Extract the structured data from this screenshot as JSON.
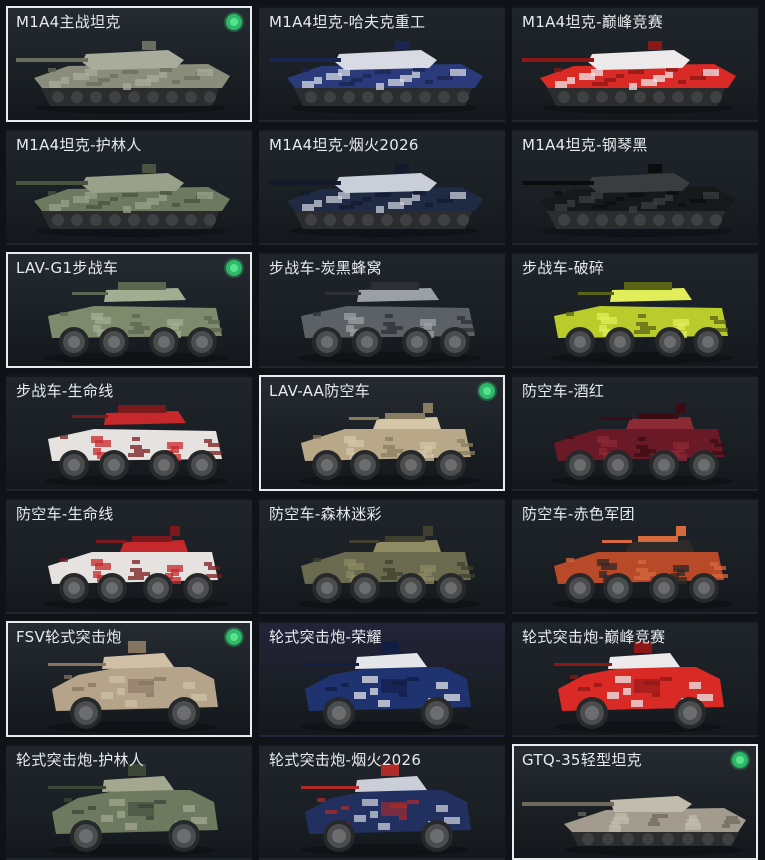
{
  "vehicles": [
    {
      "label": "M1A4主战坦克",
      "selected": true,
      "owned": true,
      "type": "tank",
      "colors": [
        "#8a8d7c",
        "#a9ab9b",
        "#6a6e5e"
      ],
      "bg": "#252b31"
    },
    {
      "label": "M1A4坦克-哈夫克重工",
      "selected": false,
      "owned": false,
      "type": "tank",
      "colors": [
        "#2a3a7a",
        "#d8dbe3",
        "#1c2550"
      ],
      "bg": "#1f252b"
    },
    {
      "label": "M1A4坦克-巅峰竞赛",
      "selected": false,
      "owned": false,
      "type": "tank",
      "colors": [
        "#d92a26",
        "#eceaea",
        "#8c1816"
      ],
      "bg": "#1f252b"
    },
    {
      "label": "M1A4坦克-护林人",
      "selected": false,
      "owned": false,
      "type": "tank",
      "colors": [
        "#6d7a5f",
        "#9aa18a",
        "#4a5441"
      ],
      "bg": "#1f252b"
    },
    {
      "label": "M1A4坦克-烟火2026",
      "selected": false,
      "owned": false,
      "type": "tank",
      "colors": [
        "#1f2a44",
        "#c9ced8",
        "#121a2c"
      ],
      "bg": "#1f252b"
    },
    {
      "label": "M1A4坦克-钢琴黑",
      "selected": false,
      "owned": false,
      "type": "tank",
      "colors": [
        "#16181a",
        "#3a3d40",
        "#0b0c0d"
      ],
      "bg": "#1f252b"
    },
    {
      "label": "LAV-G1步战车",
      "selected": true,
      "owned": true,
      "type": "ifv",
      "colors": [
        "#7e8a6c",
        "#a3ad92",
        "#5d6650"
      ],
      "bg": "#252b31"
    },
    {
      "label": "步战车-炭黑蜂窝",
      "selected": false,
      "owned": false,
      "type": "ifv",
      "colors": [
        "#5c6166",
        "#9aa0a4",
        "#2c2f33"
      ],
      "bg": "#1f252b"
    },
    {
      "label": "步战车-破碎",
      "selected": false,
      "owned": false,
      "type": "ifv",
      "colors": [
        "#b9cc2c",
        "#e1ee5a",
        "#5a6416"
      ],
      "bg": "#1f252b"
    },
    {
      "label": "步战车-生命线",
      "selected": false,
      "owned": false,
      "type": "ifv",
      "colors": [
        "#e6e2e0",
        "#c7282c",
        "#7a1a1c"
      ],
      "bg": "#1f252b"
    },
    {
      "label": "LAV-AA防空车",
      "selected": true,
      "owned": true,
      "type": "aa",
      "colors": [
        "#b8a888",
        "#d4c6a7",
        "#8a7c60"
      ],
      "bg": "#252b31"
    },
    {
      "label": "防空车-酒红",
      "selected": false,
      "owned": false,
      "type": "aa",
      "colors": [
        "#6a1a26",
        "#8c2a36",
        "#3c0c14"
      ],
      "bg": "#1f252b"
    },
    {
      "label": "防空车-生命线",
      "selected": false,
      "owned": false,
      "type": "aa",
      "colors": [
        "#e6e2e0",
        "#c7282c",
        "#7a1a1c"
      ],
      "bg": "#1f252b"
    },
    {
      "label": "防空车-森林迷彩",
      "selected": false,
      "owned": false,
      "type": "aa",
      "colors": [
        "#6a6b4e",
        "#8e8a62",
        "#3f4030"
      ],
      "bg": "#1f252b"
    },
    {
      "label": "防空车-赤色军团",
      "selected": false,
      "owned": false,
      "type": "aa",
      "colors": [
        "#b84a2a",
        "#2e2a28",
        "#d66a3c"
      ],
      "bg": "#1f252b"
    },
    {
      "label": "FSV轮式突击炮",
      "selected": true,
      "owned": true,
      "type": "fsv",
      "colors": [
        "#b6a48a",
        "#cfc0a6",
        "#857560"
      ],
      "bg": "#252b31"
    },
    {
      "label": "轮式突击炮-荣耀",
      "selected": false,
      "owned": false,
      "type": "fsv",
      "colors": [
        "#1e3370",
        "#e4e6ea",
        "#111d44"
      ],
      "bg": "#23233a"
    },
    {
      "label": "轮式突击炮-巅峰竞赛",
      "selected": false,
      "owned": false,
      "type": "fsv",
      "colors": [
        "#d92a26",
        "#eceaea",
        "#8c1816"
      ],
      "bg": "#1f252b"
    },
    {
      "label": "轮式突击炮-护林人",
      "selected": false,
      "owned": false,
      "type": "fsv",
      "colors": [
        "#6d7a5f",
        "#a3a88f",
        "#3e4638"
      ],
      "bg": "#1f252b"
    },
    {
      "label": "轮式突击炮-烟火2026",
      "selected": false,
      "owned": false,
      "type": "fsv",
      "colors": [
        "#223060",
        "#c9ced8",
        "#b02a2a"
      ],
      "bg": "#1f252b"
    },
    {
      "label": "GTQ-35轻型坦克",
      "selected": true,
      "owned": true,
      "type": "light",
      "colors": [
        "#a39c8e",
        "#c2bcae",
        "#6f695e"
      ],
      "bg": "#252b31"
    }
  ]
}
